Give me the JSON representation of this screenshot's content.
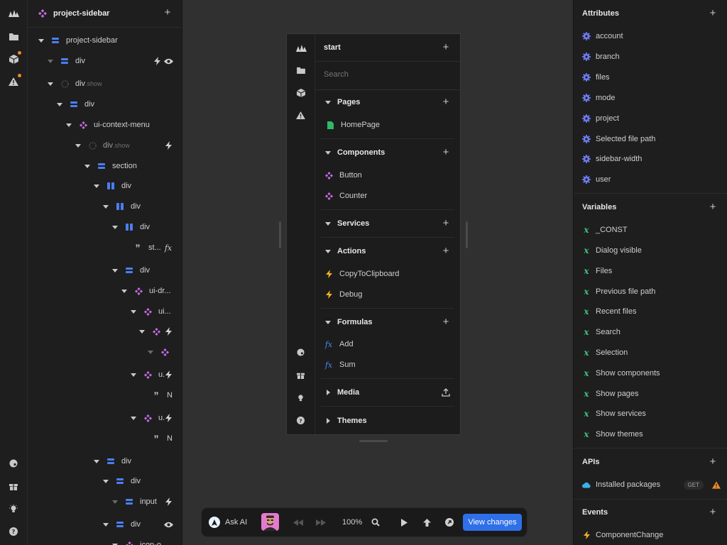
{
  "tree": {
    "title": "project-sidebar",
    "nodes": [
      {
        "label": "project-sidebar",
        "suffix": ""
      },
      {
        "label": "div",
        "suffix": ""
      },
      {
        "label": "div",
        "suffix": ".show"
      },
      {
        "label": "div",
        "suffix": ""
      },
      {
        "label": "ui-context-menu",
        "suffix": ""
      },
      {
        "label": "div",
        "suffix": ".show"
      },
      {
        "label": "section",
        "suffix": ""
      },
      {
        "label": "div",
        "suffix": ""
      },
      {
        "label": "div",
        "suffix": ""
      },
      {
        "label": "div",
        "suffix": ""
      },
      {
        "label": "st...",
        "suffix": ""
      },
      {
        "label": "div",
        "suffix": ""
      },
      {
        "label": "ui-dr...",
        "suffix": ""
      },
      {
        "label": "ui...",
        "suffix": ""
      },
      {
        "label": "",
        "suffix": ""
      },
      {
        "label": "",
        "suffix": ""
      },
      {
        "label": "u.",
        "suffix": ""
      },
      {
        "label": "N",
        "suffix": ""
      },
      {
        "label": "u.",
        "suffix": ""
      },
      {
        "label": "N",
        "suffix": ""
      },
      {
        "label": "div",
        "suffix": ""
      },
      {
        "label": "div",
        "suffix": ""
      },
      {
        "label": "input",
        "suffix": ""
      },
      {
        "label": "div",
        "suffix": ""
      },
      {
        "label": "icon-o",
        "suffix": ""
      }
    ]
  },
  "preview": {
    "title": "start",
    "search_placeholder": "Search",
    "sections": {
      "pages": "Pages",
      "components": "Components",
      "services": "Services",
      "actions": "Actions",
      "formulas": "Formulas",
      "media": "Media",
      "themes": "Themes"
    },
    "pages": [
      "HomePage"
    ],
    "components": [
      "Button",
      "Counter"
    ],
    "actions": [
      "CopyToClipboard",
      "Debug"
    ],
    "formulas": [
      "Add",
      "Sum"
    ]
  },
  "right": {
    "attributes_title": "Attributes",
    "attributes": [
      "account",
      "branch",
      "files",
      "mode",
      "project",
      "Selected file path",
      "sidebar-width",
      "user"
    ],
    "variables_title": "Variables",
    "variables": [
      "_CONST",
      "Dialog visible",
      "Files",
      "Previous file path",
      "Recent files",
      "Search",
      "Selection",
      "Show components",
      "Show pages",
      "Show services",
      "Show themes"
    ],
    "apis_title": "APIs",
    "apis": [
      {
        "name": "Installed packages",
        "method": "GET"
      }
    ],
    "events_title": "Events",
    "events": [
      "ComponentChange"
    ]
  },
  "toolbar": {
    "ask_ai": "Ask AI",
    "zoom": "100%",
    "view_changes": "View changes"
  },
  "colors": {
    "accent": "#2f6fe8",
    "component": "#c86ae6",
    "element": "#4b7ff0",
    "variable": "#3ec279",
    "action": "#f2b01e",
    "warning": "#f08a24"
  }
}
